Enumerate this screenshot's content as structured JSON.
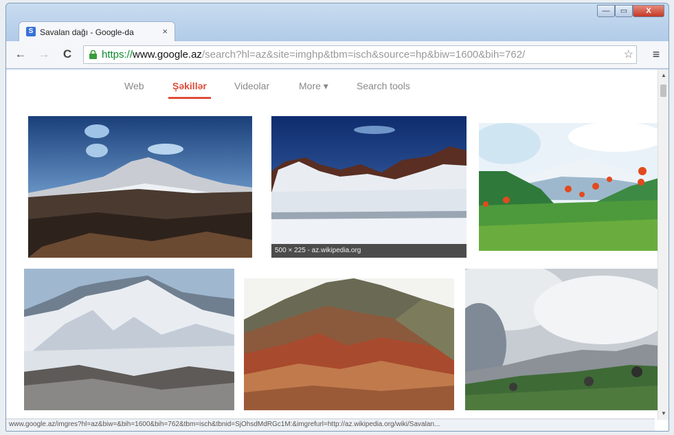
{
  "tab": {
    "title": "Savalan dağı - Google-da",
    "favicon": "S",
    "close": "×"
  },
  "window_controls": {
    "min": "—",
    "max": "▭",
    "close": "X"
  },
  "toolbar": {
    "url_scheme": "https://",
    "url_host": "www.google.az",
    "url_path": "/search?hl=az&site=imghp&tbm=isch&source=hp&biw=1600&bih=762/",
    "back": "←",
    "forward": "→",
    "reload": "C",
    "star": "☆",
    "menu": "≡"
  },
  "search_tabs": {
    "web": "Web",
    "images": "Şəkillər",
    "videos": "Videolar",
    "more": "More ▾",
    "tools": "Search tools"
  },
  "results": {
    "caption_2": "500 × 225 - az.wikipedia.org"
  },
  "status_url": "www.google.az/imgres?hl=az&biw=&bih=1600&bih=762&tbm=isch&tbnid=SjOhsdMdRGc1M:&imgrefurl=http://az.wikipedia.org/wiki/Savalan...",
  "icons": {
    "lock": "lock-icon",
    "star": "star-icon",
    "menu": "hamburger-menu-icon",
    "back": "back-arrow-icon",
    "forward": "forward-arrow-icon",
    "reload": "reload-icon"
  },
  "colors": {
    "accent": "#dd4b39",
    "secure": "#0a8c2e"
  }
}
